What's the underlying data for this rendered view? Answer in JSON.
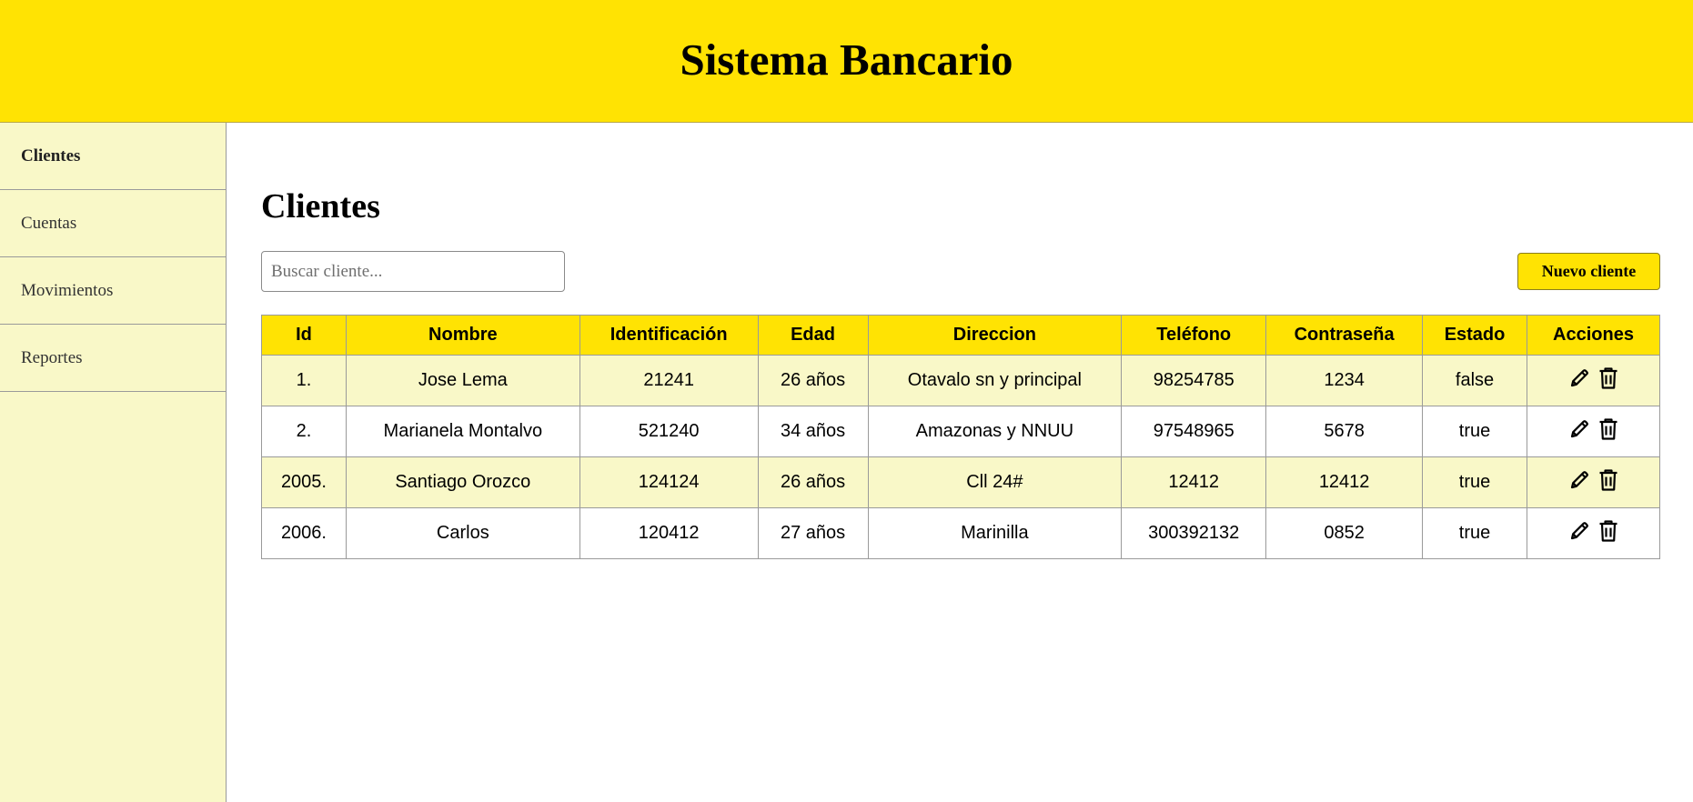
{
  "app": {
    "title": "Sistema Bancario"
  },
  "sidebar": {
    "items": [
      {
        "label": "Clientes",
        "active": true
      },
      {
        "label": "Cuentas",
        "active": false
      },
      {
        "label": "Movimientos",
        "active": false
      },
      {
        "label": "Reportes",
        "active": false
      }
    ]
  },
  "main": {
    "title": "Clientes",
    "search": {
      "placeholder": "Buscar cliente...",
      "value": ""
    },
    "new_button_label": "Nuevo cliente"
  },
  "table": {
    "headers": [
      "Id",
      "Nombre",
      "Identificación",
      "Edad",
      "Direccion",
      "Teléfono",
      "Contraseña",
      "Estado",
      "Acciones"
    ],
    "rows": [
      {
        "id": "1.",
        "nombre": "Jose Lema",
        "identificacion": "21241",
        "edad": "26 años",
        "direccion": "Otavalo sn y principal",
        "telefono": "98254785",
        "contrasena": "1234",
        "estado": "false"
      },
      {
        "id": "2.",
        "nombre": "Marianela Montalvo",
        "identificacion": "521240",
        "edad": "34 años",
        "direccion": "Amazonas y NNUU",
        "telefono": "97548965",
        "contrasena": "5678",
        "estado": "true"
      },
      {
        "id": "2005.",
        "nombre": "Santiago Orozco",
        "identificacion": "124124",
        "edad": "26 años",
        "direccion": "Cll 24#",
        "telefono": "12412",
        "contrasena": "12412",
        "estado": "true"
      },
      {
        "id": "2006.",
        "nombre": "Carlos",
        "identificacion": "120412",
        "edad": "27 años",
        "direccion": "Marinilla",
        "telefono": "300392132",
        "contrasena": "0852",
        "estado": "true"
      }
    ],
    "row_actions": [
      "pencil-icon",
      "trash-icon"
    ]
  },
  "colors": {
    "accent": "#ffe303",
    "sidebar_bg": "#f9f8c8",
    "row_alt_bg": "#f9f8c8",
    "border": "#9a9a9a"
  }
}
